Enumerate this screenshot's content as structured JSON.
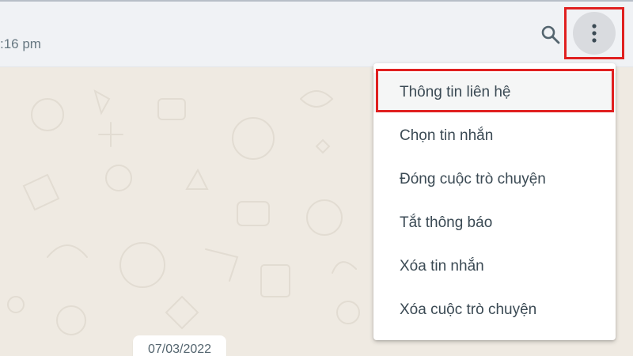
{
  "header": {
    "last_seen": ":16 pm",
    "search_icon": "search-icon",
    "menu_icon": "vertical-dots-icon"
  },
  "menu": {
    "items": [
      {
        "label": "Thông tin liên hệ",
        "active": true
      },
      {
        "label": "Chọn tin nhắn"
      },
      {
        "label": "Đóng cuộc trò chuyện"
      },
      {
        "label": "Tắt thông báo"
      },
      {
        "label": "Xóa tin nhắn"
      },
      {
        "label": "Xóa cuộc trò chuyện"
      }
    ]
  },
  "chat": {
    "date_label": "07/03/2022"
  },
  "colors": {
    "header_bg": "#f0f2f5",
    "wallpaper": "#efeae2",
    "highlight": "#e02020",
    "menu_text": "#3b4a54",
    "icon": "#54656f"
  }
}
